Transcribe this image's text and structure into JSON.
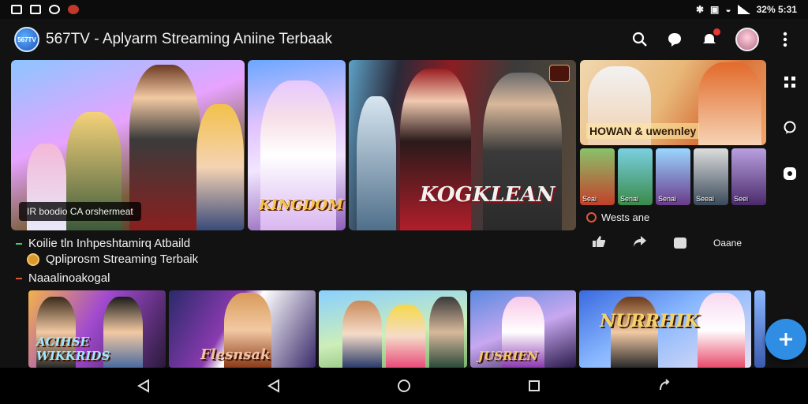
{
  "status_bar": {
    "left_icons": [
      "image-icon",
      "gallery-icon",
      "ornament-icon",
      "app-icon"
    ],
    "right_text": "32% 5:31",
    "right_icons": [
      "bluetooth-icon",
      "nfc-icon",
      "wifi-icon",
      "signal-icon"
    ]
  },
  "app_bar": {
    "logo_text": "567TV",
    "title": "567TV - Aplyarm Streaming Aniine Terbaak"
  },
  "hero": {
    "caption": "IR boodio CA orshermeat",
    "logo_left": "KINGDOM",
    "logo_right": "KOGKLEAN"
  },
  "side_card": {
    "logo": "HOWAN & uwennley",
    "mini_labels": [
      "Seai",
      "Senai",
      "Senai",
      "Seeai",
      "Seei"
    ],
    "label": "Wests ane",
    "action_text": "Oaane"
  },
  "rows": {
    "line1": "Koilie tln Inhpeshtamirq Atbaild",
    "line2": "Qpliprosm Streaming Terbaik",
    "line3": "Naaalinoakogal"
  },
  "carousel": {
    "titles": [
      "ACIHSE WIKKRIDS",
      "Flesnsak",
      "",
      "JUSRIEN",
      "NURRHIK"
    ]
  },
  "colors": {
    "background": "#121212",
    "fab": "#2f8de4",
    "accent_red": "#e2553a",
    "accent_green": "#3ccf7a"
  }
}
